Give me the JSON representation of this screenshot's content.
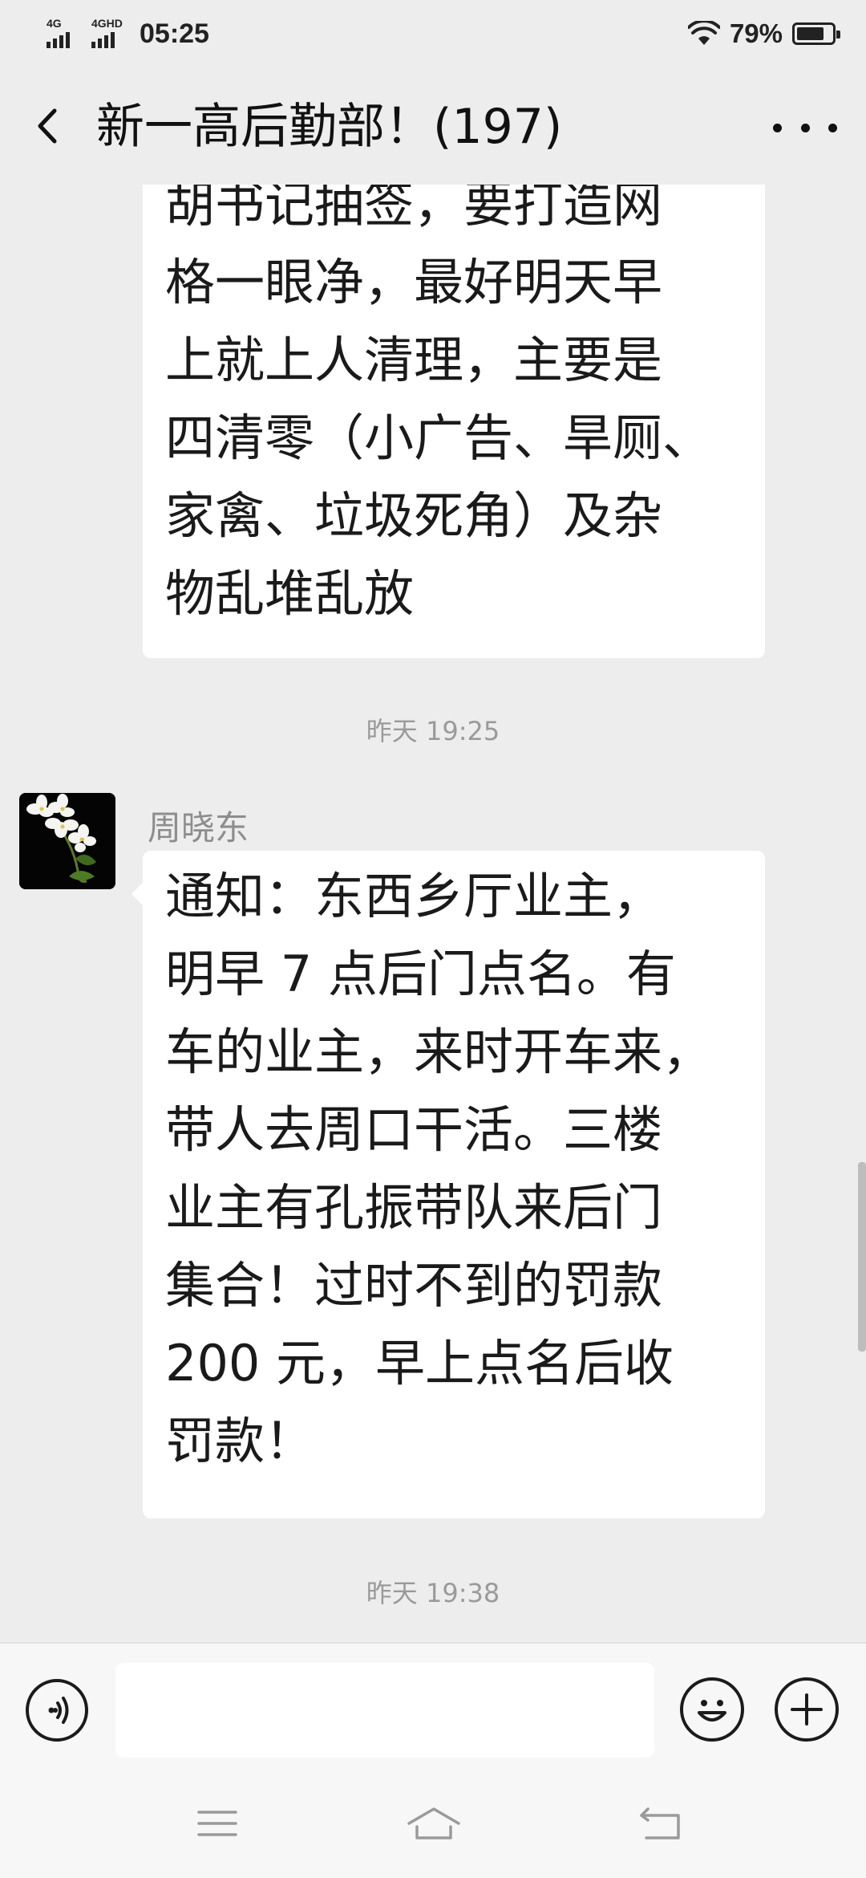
{
  "status_bar": {
    "signal_1": "4G",
    "signal_2": "4GHD",
    "time": "05:25",
    "battery_percent": "79%",
    "battery_level": 0.79
  },
  "header": {
    "title": "新一高后勤部！(197)"
  },
  "messages": [
    {
      "text": "胡书记抽签，要打造网\n格一眼净，最好明天早\n上就上人清理，主要是\n四清零（小广告、旱厕、\n家禽、垃圾死角）及杂\n物乱堆乱放"
    },
    {
      "timestamp": "昨天 19:25"
    },
    {
      "sender": "周晓东",
      "text": "通知：东西乡厅业主，\n明早 7 点后门点名。有\n车的业主，来时开车来，\n带人去周口干活。三楼\n业主有孔振带队来后门\n集合！过时不到的罚款\n200 元，早上点名后收\n罚款！"
    },
    {
      "timestamp": "昨天 19:38"
    }
  ],
  "input_bar": {
    "value": ""
  },
  "colors": {
    "background": "#ededed",
    "bubble": "#ffffff",
    "timestamp": "#9a9a9a",
    "sender_name": "#8d8d8d"
  },
  "icons": {
    "back": "chevron-left-icon",
    "more": "more-dots-icon",
    "voice": "voice-icon",
    "emoji": "emoji-icon",
    "plus": "plus-icon",
    "nav_menu": "menu-icon",
    "nav_home": "home-icon",
    "nav_back": "nav-back-icon"
  }
}
